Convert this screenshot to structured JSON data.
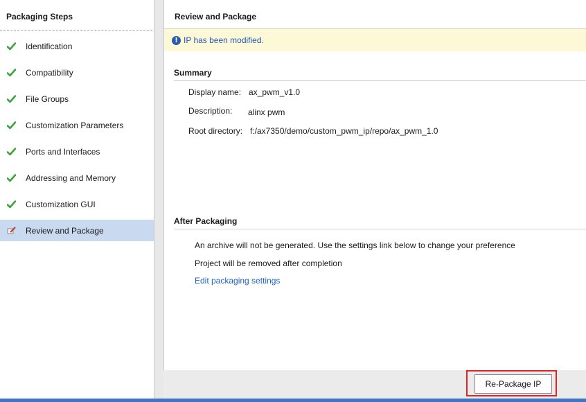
{
  "left": {
    "title": "Packaging Steps",
    "steps": [
      {
        "label": "Identification",
        "icon": "check-icon"
      },
      {
        "label": "Compatibility",
        "icon": "check-icon"
      },
      {
        "label": "File Groups",
        "icon": "check-icon"
      },
      {
        "label": "Customization Parameters",
        "icon": "check-icon"
      },
      {
        "label": "Ports and Interfaces",
        "icon": "check-icon"
      },
      {
        "label": "Addressing and Memory",
        "icon": "check-icon"
      },
      {
        "label": "Customization GUI",
        "icon": "check-icon"
      },
      {
        "label": "Review and Package",
        "icon": "edit-icon"
      }
    ]
  },
  "right": {
    "title": "Review and Package",
    "banner": {
      "text": "IP has been modified.",
      "icon": "info-icon"
    },
    "summary": {
      "heading": "Summary",
      "display_name_key": "Display name:",
      "display_name_value": "ax_pwm_v1.0",
      "description_key": "Description:",
      "description_value": "alinx pwm",
      "root_dir_key": "Root directory:",
      "root_dir_value": "f:/ax7350/demo/custom_pwm_ip/repo/ax_pwm_1.0"
    },
    "after": {
      "heading": "After Packaging",
      "line1": "An archive will not be generated. Use the settings link below to change your preference",
      "line2": "Project will be removed after completion",
      "link": "Edit packaging settings"
    }
  },
  "footer": {
    "repackage_label": "Re-Package IP"
  },
  "colors": {
    "check": "#3aa33a",
    "active_row": "#c9d9ef",
    "banner_bg": "#fdf9d6",
    "link": "#1f63c6",
    "highlight": "#e02424",
    "status_strip": "#3f74c6"
  }
}
